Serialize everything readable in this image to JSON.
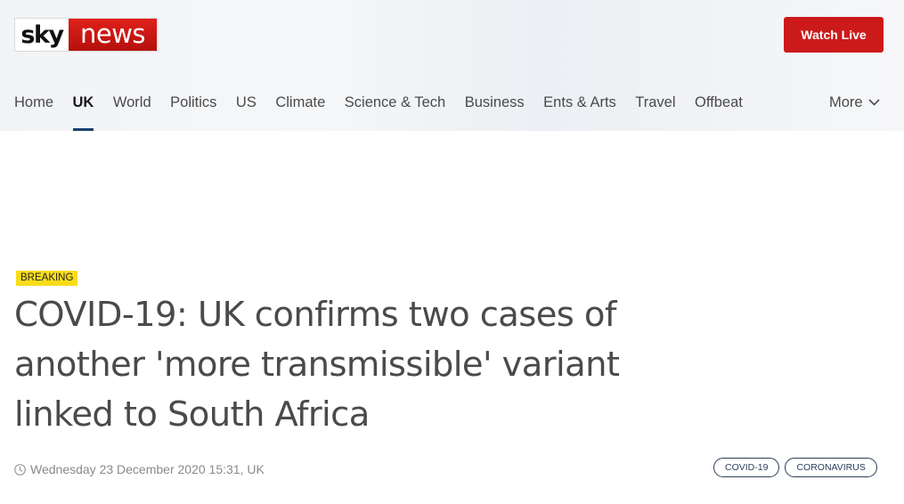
{
  "logo": {
    "sky": "sky",
    "news": "news"
  },
  "header": {
    "watch_live_label": "Watch Live"
  },
  "nav": {
    "items": [
      {
        "label": "Home"
      },
      {
        "label": "UK",
        "active": true
      },
      {
        "label": "World"
      },
      {
        "label": "Politics"
      },
      {
        "label": "US"
      },
      {
        "label": "Climate"
      },
      {
        "label": "Science & Tech"
      },
      {
        "label": "Business"
      },
      {
        "label": "Ents & Arts"
      },
      {
        "label": "Travel"
      },
      {
        "label": "Offbeat"
      }
    ],
    "more_label": "More"
  },
  "article": {
    "badge": "BREAKING",
    "headline": "COVID-19: UK confirms two cases of another 'more transmissible' variant linked to South Africa",
    "dateline": "Wednesday 23 December 2020 15:31, UK",
    "tags": [
      "COVID-19",
      "CORONAVIRUS"
    ]
  },
  "colors": {
    "brand_red": "#cc1a1b",
    "active_underline": "#1b3f6e",
    "breaking_yellow": "#f9dc1b",
    "tag_border": "#2c3e5c"
  },
  "icons": {
    "more": "chevron-down-icon",
    "dateline": "clock-icon"
  }
}
